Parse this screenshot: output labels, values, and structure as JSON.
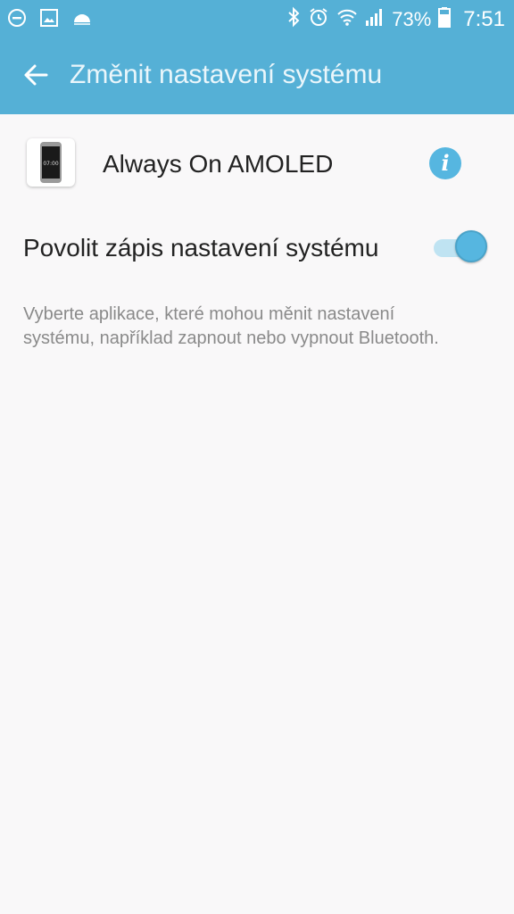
{
  "status_bar": {
    "battery_percent": "73%",
    "time": "7:51",
    "left_icons": [
      "do-not-disturb-icon",
      "gallery-icon",
      "weather-icon"
    ],
    "right_icons": [
      "bluetooth-icon",
      "alarm-icon",
      "wifi-icon",
      "signal-icon",
      "battery-icon"
    ]
  },
  "app_bar": {
    "title": "Změnit nastavení systému",
    "background": "#55b0d6"
  },
  "app": {
    "name": "Always On AMOLED",
    "icon_time": "07:00"
  },
  "setting": {
    "label": "Povolit zápis nastavení systému",
    "enabled": true,
    "accent": "#56b6e0"
  },
  "description": "Vyberte aplikace, které mohou měnit nastavení systému, například zapnout nebo vypnout Bluetooth."
}
